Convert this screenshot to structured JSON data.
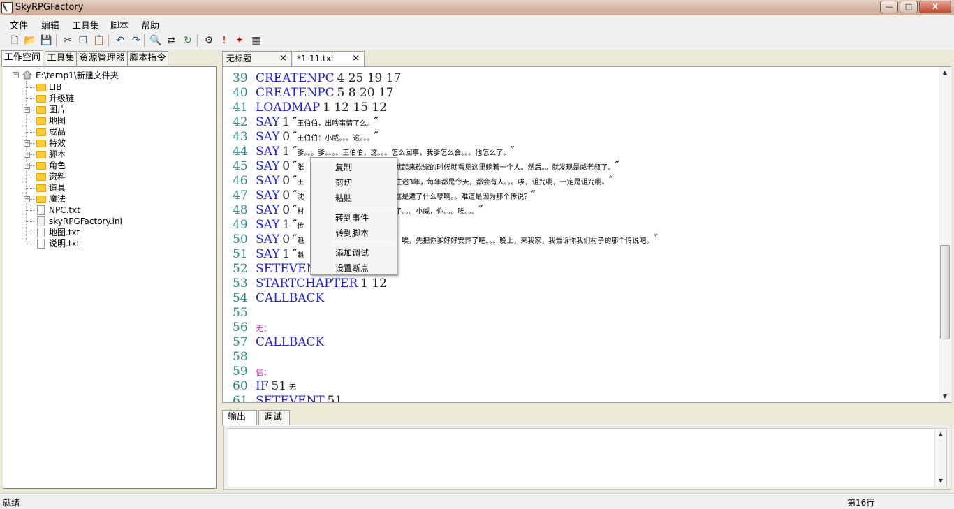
{
  "window": {
    "title": "SkyRPGFactory",
    "min_glyph": "—",
    "max_glyph": "□",
    "close_glyph": "X"
  },
  "menubar": {
    "items": [
      "文件",
      "编辑",
      "工具集",
      "脚本",
      "帮助"
    ]
  },
  "toolbar": {
    "buttons": [
      {
        "icon": "new-file-icon",
        "glyph": "🗋"
      },
      {
        "icon": "open-folder-icon",
        "glyph": "📂"
      },
      {
        "icon": "save-icon",
        "glyph": "💾"
      },
      {
        "icon": "cut-icon",
        "glyph": "✂"
      },
      {
        "icon": "copy-icon",
        "glyph": "❐"
      },
      {
        "icon": "paste-icon",
        "glyph": "📋"
      },
      {
        "icon": "undo-icon",
        "glyph": "↶"
      },
      {
        "icon": "redo-icon",
        "glyph": "↷"
      },
      {
        "icon": "find-icon",
        "glyph": "🔍"
      },
      {
        "icon": "replace-icon",
        "glyph": "⇄"
      },
      {
        "icon": "refresh-icon",
        "glyph": "↻"
      },
      {
        "icon": "compile-icon",
        "glyph": "⚙"
      },
      {
        "icon": "error-icon",
        "glyph": "!"
      },
      {
        "icon": "debug-icon",
        "glyph": "✦"
      },
      {
        "icon": "calendar-icon",
        "glyph": "▦"
      }
    ]
  },
  "left_tabs": [
    "工作空间",
    "工具集",
    "资源管理器",
    "脚本指令"
  ],
  "tree": {
    "root": "E:\\temp1\\新建文件夹",
    "items": [
      {
        "label": "LIB",
        "type": "folder",
        "expandable": false
      },
      {
        "label": "升级链",
        "type": "folder",
        "expandable": false
      },
      {
        "label": "图片",
        "type": "folder",
        "expandable": true
      },
      {
        "label": "地图",
        "type": "folder",
        "expandable": false
      },
      {
        "label": "成品",
        "type": "folder",
        "expandable": false
      },
      {
        "label": "特效",
        "type": "folder",
        "expandable": true
      },
      {
        "label": "脚本",
        "type": "folder",
        "expandable": true
      },
      {
        "label": "角色",
        "type": "folder",
        "expandable": true
      },
      {
        "label": "资料",
        "type": "folder",
        "expandable": false
      },
      {
        "label": "道具",
        "type": "folder",
        "expandable": false
      },
      {
        "label": "魔法",
        "type": "folder",
        "expandable": true
      },
      {
        "label": "NPC.txt",
        "type": "file",
        "expandable": false
      },
      {
        "label": "skyRPGFactory.ini",
        "type": "ini",
        "expandable": false
      },
      {
        "label": "地图.txt",
        "type": "file",
        "expandable": false
      },
      {
        "label": "说明.txt",
        "type": "file",
        "expandable": false
      }
    ]
  },
  "editor_tabs": [
    {
      "label": "无标题",
      "close": "×"
    },
    {
      "label": "*1-11.txt",
      "close": "×"
    }
  ],
  "code_lines": [
    {
      "n": "39",
      "kw": "CREATENPC",
      "args": "4 25 19 17",
      "str": "",
      "label": ""
    },
    {
      "n": "40",
      "kw": "CREATENPC",
      "args": "5 8 20 17",
      "str": "",
      "label": ""
    },
    {
      "n": "41",
      "kw": "LOADMAP",
      "args": "1 12 15 12",
      "str": "",
      "label": ""
    },
    {
      "n": "42",
      "kw": "SAY",
      "args": "1",
      "str": "王伯伯，出啥事情了么。",
      "label": ""
    },
    {
      "n": "43",
      "kw": "SAY",
      "args": "0",
      "str": "王伯伯：小威。。。这。。。",
      "label": ""
    },
    {
      "n": "44",
      "kw": "SAY",
      "args": "1",
      "str": "爹。。。爹。。。。王伯伯，这。。。怎么回事，我爹怎么会。。。他怎么了。",
      "label": ""
    },
    {
      "n": "45",
      "kw": "SAY",
      "args": "0",
      "str": "张",
      "tail": "就起来砍柴的时候就看见这里躺着一个人。然后。。就发现是威老叔了。",
      "label": ""
    },
    {
      "n": "46",
      "kw": "SAY",
      "args": "0",
      "str": "王",
      "tail": "往途3年，每年都是今天，都会有人。。。唉，诅咒啊，一定是诅咒啊。",
      "label": ""
    },
    {
      "n": "47",
      "kw": "SAY",
      "args": "0",
      "str": "沈",
      "tail": "这是遭了什么孽啊。。难道是因为那个传说？",
      "label": ""
    },
    {
      "n": "48",
      "kw": "SAY",
      "args": "0",
      "str": "村",
      "tail": "了。。。小威，你。。。唉。。。",
      "label": ""
    },
    {
      "n": "49",
      "kw": "SAY",
      "args": "1",
      "str": "传",
      "tail": "",
      "label": ""
    },
    {
      "n": "50",
      "kw": "SAY",
      "args": "0",
      "str": "魁",
      "tail": "。唉，先把你爹好好安葬了吧。。。晚上，来我家，我告诉你我们村子的那个传说吧。",
      "label": ""
    },
    {
      "n": "51",
      "kw": "SAY",
      "args": "1",
      "str": "魁",
      "tail": "",
      "label": ""
    },
    {
      "n": "52",
      "kw": "SETEVENT",
      "args": "",
      "str": "",
      "label": ""
    },
    {
      "n": "53",
      "kw": "STARTCHAPTER",
      "args": "1 12",
      "str": "",
      "label": ""
    },
    {
      "n": "54",
      "kw": "CALLBACK",
      "args": "",
      "str": "",
      "label": ""
    },
    {
      "n": "55",
      "kw": "",
      "args": "",
      "str": "",
      "label": ""
    },
    {
      "n": "56",
      "kw": "",
      "args": "",
      "str": "",
      "label": "无："
    },
    {
      "n": "57",
      "kw": "CALLBACK",
      "args": "",
      "str": "",
      "label": ""
    },
    {
      "n": "58",
      "kw": "",
      "args": "",
      "str": "",
      "label": ""
    },
    {
      "n": "59",
      "kw": "",
      "args": "",
      "str": "",
      "label": "信："
    },
    {
      "n": "60",
      "kw": "IF",
      "args": "51",
      "str": "",
      "suffix": "无",
      "label": ""
    },
    {
      "n": "61",
      "kw": "SETEVENT",
      "args": "51",
      "str": "",
      "label": ""
    }
  ],
  "context_menu": {
    "groups": [
      [
        "复制",
        "剪切",
        "粘贴"
      ],
      [
        "转到事件",
        "转到脚本"
      ],
      [
        "添加调试",
        "设置断点"
      ]
    ]
  },
  "output_tabs": [
    "输出",
    "调试"
  ],
  "status": {
    "left": "就绪",
    "right": "第16行"
  }
}
